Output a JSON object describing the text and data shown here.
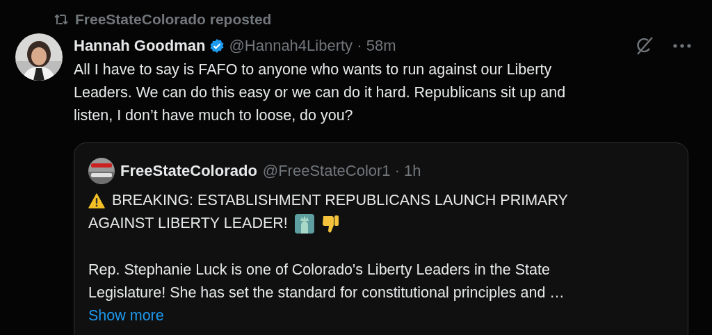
{
  "repost": {
    "label": "FreeStateColorado reposted"
  },
  "post": {
    "name": "Hannah Goodman",
    "verified": true,
    "handle": "@Hannah4Liberty · 58m",
    "text": "All I have to say is FAFO to anyone who wants to run against our Liberty\nLeaders. We can do this easy or we can do it hard. Republicans sit up and\nlisten, I don’t have much to loose, do you?"
  },
  "quote": {
    "name": "FreeStateColorado",
    "handle": "@FreeStateColor1 · 1h",
    "headline": [
      "BREAKING: ESTABLISHMENT REPUBLICANS LAUNCH PRIMARY",
      "AGAINST LIBERTY LEADER!"
    ],
    "text": "Rep. Stephanie Luck is one of Colorado's Liberty Leaders in the State\nLegislature! She has set the standard for constitutional principles and …",
    "show_more": "Show more"
  }
}
